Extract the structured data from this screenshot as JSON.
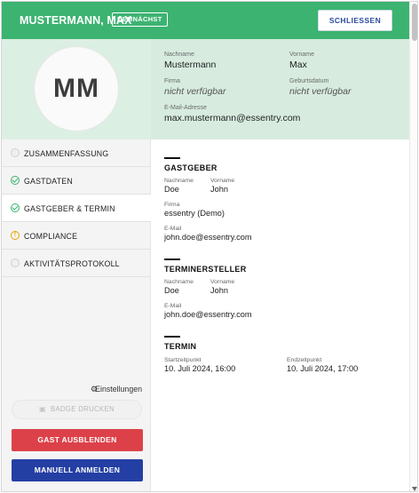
{
  "header": {
    "name": "MUSTERMANN, MAX",
    "status_badge": "DEMNÄCHST",
    "close_label": "SCHLIESSEN"
  },
  "profile": {
    "initials": "MM",
    "fields": {
      "nachname_label": "Nachname",
      "nachname_value": "Mustermann",
      "vorname_label": "Vorname",
      "vorname_value": "Max",
      "firma_label": "Firma",
      "firma_value": "nicht verfügbar",
      "geburtsdatum_label": "Geburtsdatum",
      "geburtsdatum_value": "nicht verfügbar",
      "email_label": "E-Mail-Adresse",
      "email_value": "max.mustermann@essentry.com"
    }
  },
  "sidebar": {
    "items": [
      {
        "label": "ZUSAMMENFASSUNG",
        "icon": "empty-circle-icon",
        "state": "none"
      },
      {
        "label": "GASTDATEN",
        "icon": "check-circle-icon",
        "state": "done"
      },
      {
        "label": "GASTGEBER & TERMIN",
        "icon": "check-circle-icon",
        "state": "done"
      },
      {
        "label": "COMPLIANCE",
        "icon": "warning-circle-icon",
        "state": "warning"
      },
      {
        "label": "AKTIVITÄTSPROTOKOLL",
        "icon": "empty-circle-icon",
        "state": "none"
      }
    ],
    "settings_label": "Einstellungen",
    "badge_print_label": "BADGE DRUCKEN",
    "hide_guest_label": "GAST AUSBLENDEN",
    "manual_login_label": "MANUELL ANMELDEN"
  },
  "main": {
    "host": {
      "title": "GASTGEBER",
      "nachname_label": "Nachname",
      "nachname_value": "Doe",
      "vorname_label": "Vorname",
      "vorname_value": "John",
      "firma_label": "Firma",
      "firma_value": "essentry (Demo)",
      "email_label": "E-Mail",
      "email_value": "john.doe@essentry.com"
    },
    "creator": {
      "title": "TERMINERSTELLER",
      "nachname_label": "Nachname",
      "nachname_value": "Doe",
      "vorname_label": "Vorname",
      "vorname_value": "John",
      "email_label": "E-Mail",
      "email_value": "john.doe@essentry.com"
    },
    "appointment": {
      "title": "TERMIN",
      "start_label": "Startzeitpunkt",
      "start_value": "10. Juli 2024, 16:00",
      "end_label": "Endzeitpunkt",
      "end_value": "10. Juli 2024, 17:00"
    }
  },
  "colors": {
    "header_green": "#3cb371",
    "profile_bg": "#d7ecdf",
    "danger_red": "#dc4149",
    "primary_blue": "#243fa3",
    "warning_orange": "#f0a202"
  }
}
